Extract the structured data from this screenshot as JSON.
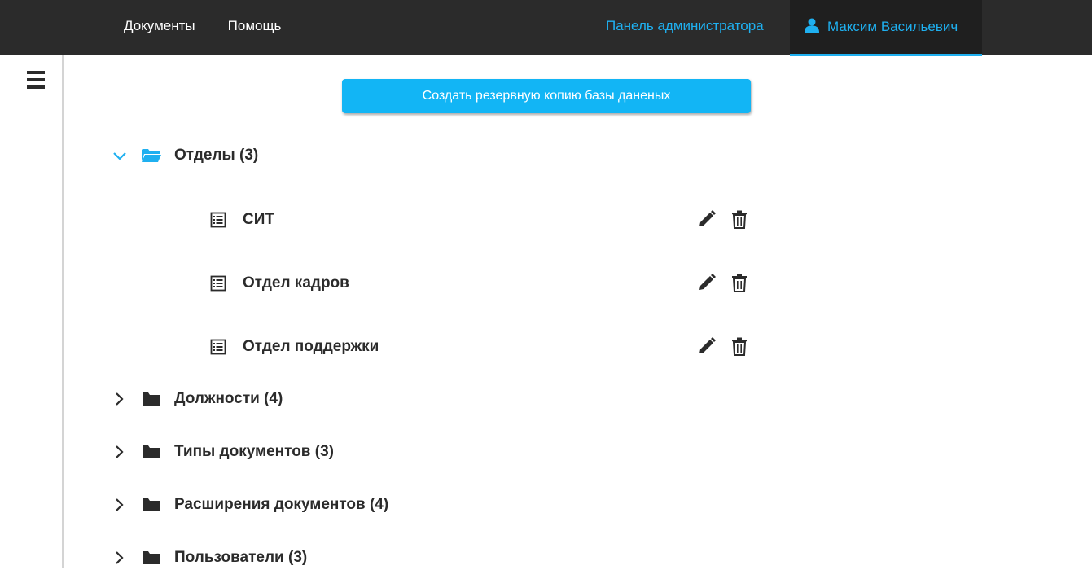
{
  "nav": {
    "documents_label": "Документы",
    "help_label": "Помощь",
    "admin_panel_label": "Панель администратора",
    "user_name": "Максим Васильевич",
    "user_icon": "user-icon"
  },
  "sidebar": {
    "menu_icon": "hamburger-icon"
  },
  "actions": {
    "backup_label": "Создать резервную копию базы даненых"
  },
  "tree": {
    "categories": [
      {
        "label": "Отделы (3)",
        "expanded": true,
        "items": [
          {
            "label": "СИТ"
          },
          {
            "label": "Отдел кадров"
          },
          {
            "label": "Отдел поддержки"
          }
        ]
      },
      {
        "label": "Должности (4)",
        "expanded": false
      },
      {
        "label": "Типы документов (3)",
        "expanded": false
      },
      {
        "label": "Расширения документов (4)",
        "expanded": false
      },
      {
        "label": "Пользователи (3)",
        "expanded": false
      }
    ]
  },
  "colors": {
    "accent": "#1fb0f0",
    "navbar_bg": "#2b2b2b",
    "button_bg": "#12b5f5",
    "text_dark": "#2b2b2b"
  }
}
